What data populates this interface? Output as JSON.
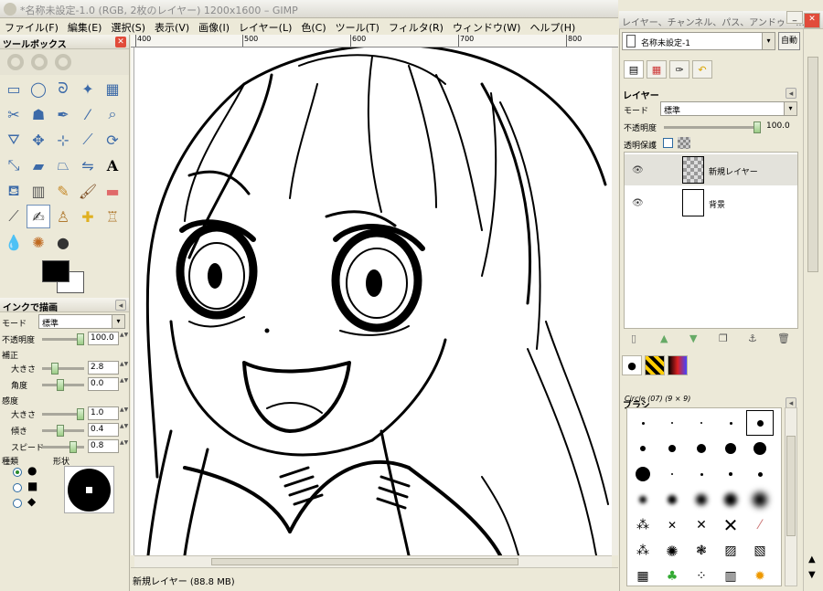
{
  "window": {
    "title": "*名称未設定-1.0 (RGB, 2枚のレイヤー) 1200x1600 – GIMP"
  },
  "menu": [
    "ファイル(F)",
    "編集(E)",
    "選択(S)",
    "表示(V)",
    "画像(I)",
    "レイヤー(L)",
    "色(C)",
    "ツール(T)",
    "フィルタ(R)",
    "ウィンドウ(W)",
    "ヘルプ(H)"
  ],
  "toolbox": {
    "title": "ツールボックス",
    "tools": [
      "rect-select",
      "ellipse-select",
      "free-select",
      "fuzzy-select",
      "color-select",
      "scissors",
      "foreground-select",
      "paths",
      "color-picker",
      "zoom",
      "measure",
      "move",
      "align",
      "crop",
      "rotate",
      "scale",
      "shear",
      "perspective",
      "flip",
      "text",
      "bucket-fill",
      "blend",
      "pencil",
      "paintbrush",
      "eraser",
      "airbrush",
      "ink",
      "clone",
      "heal",
      "perspective-clone",
      "smudge",
      "dodge-burn",
      "convolve"
    ],
    "colors": {
      "fg": "#000000",
      "bg": "#ffffff"
    }
  },
  "tool_options": {
    "title": "インクで描画",
    "mode_label": "モード",
    "mode_value": "標準",
    "opacity_label": "不透明度",
    "opacity_value": "100.0",
    "adjust_label": "補正",
    "size_label": "大きさ",
    "size_value": "2.8",
    "angle_label": "角度",
    "angle_value": "0.0",
    "sensitivity_label": "感度",
    "sens_size_label": "大きさ",
    "sens_size_value": "1.0",
    "tilt_label": "傾き",
    "tilt_value": "0.4",
    "speed_label": "スピード",
    "speed_value": "0.8",
    "type_label": "種類",
    "shape_label": "形状"
  },
  "rulers": {
    "ticks": [
      "400",
      "500",
      "600",
      "700",
      "800"
    ]
  },
  "status": {
    "text": "新規レイヤー (88.8 MB)"
  },
  "dock": {
    "title": "レイヤー、チャンネル、パス、アンドゥ – ...",
    "image_select": "名称未設定-1",
    "auto_button": "自動",
    "layers_title": "レイヤー",
    "mode_label": "モード",
    "mode_value": "標準",
    "opacity_label": "不透明度",
    "opacity_value": "100.0",
    "lock_label": "透明保護",
    "layers": [
      {
        "name": "新規レイヤー"
      },
      {
        "name": "背景"
      }
    ],
    "brushes_title": "ブラシ",
    "brush_name": "Circle (07) (9 × 9)"
  }
}
